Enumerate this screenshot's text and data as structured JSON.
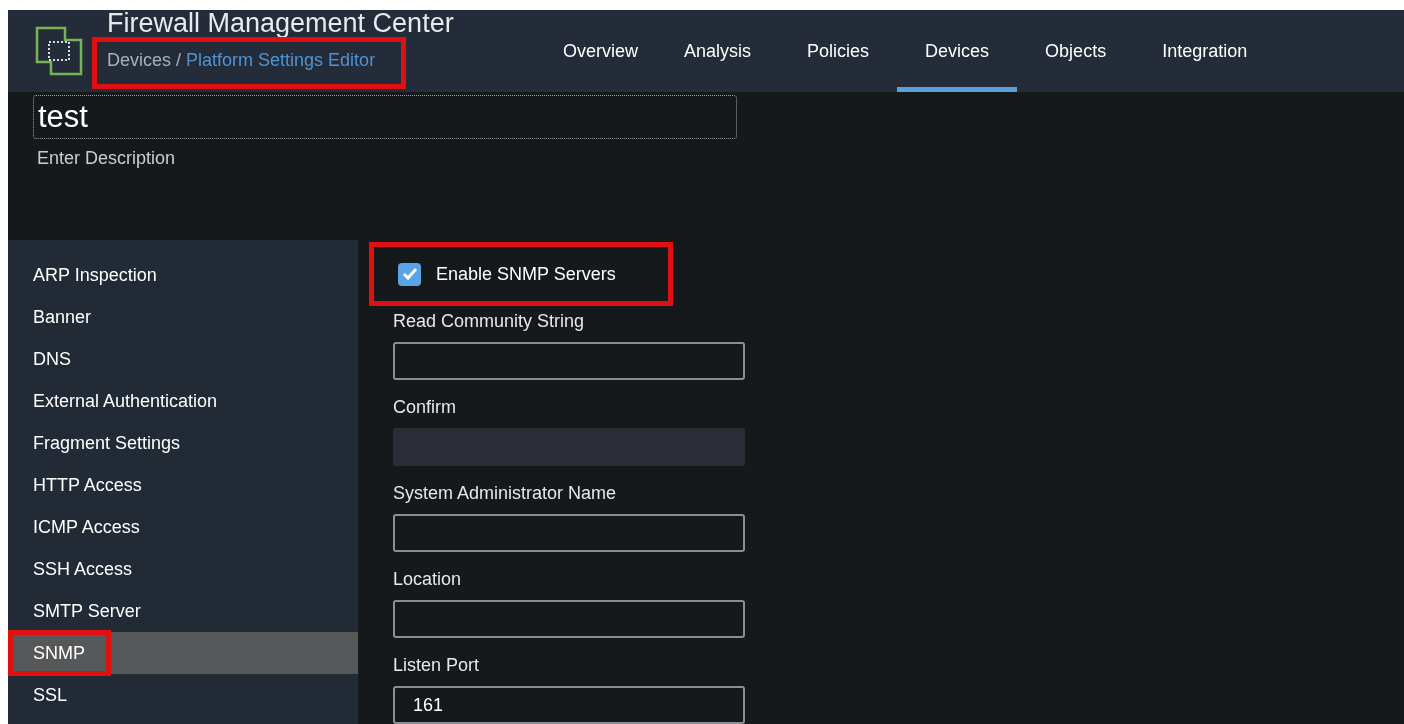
{
  "header": {
    "title": "Firewall Management Center",
    "breadcrumb": {
      "parent": "Devices",
      "separator": "/",
      "current": "Platform Settings Editor",
      "highlighted": true
    }
  },
  "nav": [
    {
      "label": "Overview",
      "selected": false
    },
    {
      "label": "Analysis",
      "selected": false
    },
    {
      "label": "Policies",
      "selected": false
    },
    {
      "label": "Devices",
      "selected": true
    },
    {
      "label": "Objects",
      "selected": false
    },
    {
      "label": "Integration",
      "selected": false
    }
  ],
  "policy": {
    "name": "test",
    "description_placeholder": "Enter Description"
  },
  "sidebar": {
    "items": [
      {
        "label": "ARP Inspection",
        "selected": false,
        "highlighted": false
      },
      {
        "label": "Banner",
        "selected": false,
        "highlighted": false
      },
      {
        "label": "DNS",
        "selected": false,
        "highlighted": false
      },
      {
        "label": "External Authentication",
        "selected": false,
        "highlighted": false
      },
      {
        "label": "Fragment Settings",
        "selected": false,
        "highlighted": false
      },
      {
        "label": "HTTP Access",
        "selected": false,
        "highlighted": false
      },
      {
        "label": "ICMP Access",
        "selected": false,
        "highlighted": false
      },
      {
        "label": "SSH Access",
        "selected": false,
        "highlighted": false
      },
      {
        "label": "SMTP Server",
        "selected": false,
        "highlighted": false
      },
      {
        "label": "SNMP",
        "selected": true,
        "highlighted": true
      },
      {
        "label": "SSL",
        "selected": false,
        "highlighted": false
      }
    ]
  },
  "snmp": {
    "enable": {
      "label": "Enable SNMP Servers",
      "checked": true,
      "highlighted": true
    },
    "fields": [
      {
        "label": "Read Community String",
        "disabled": false
      },
      {
        "label": "Confirm",
        "disabled": true
      },
      {
        "label": "System Administrator Name",
        "disabled": false
      },
      {
        "label": "Location",
        "disabled": false
      },
      {
        "label": "Listen Port",
        "value": "161",
        "disabled": false
      }
    ]
  }
}
